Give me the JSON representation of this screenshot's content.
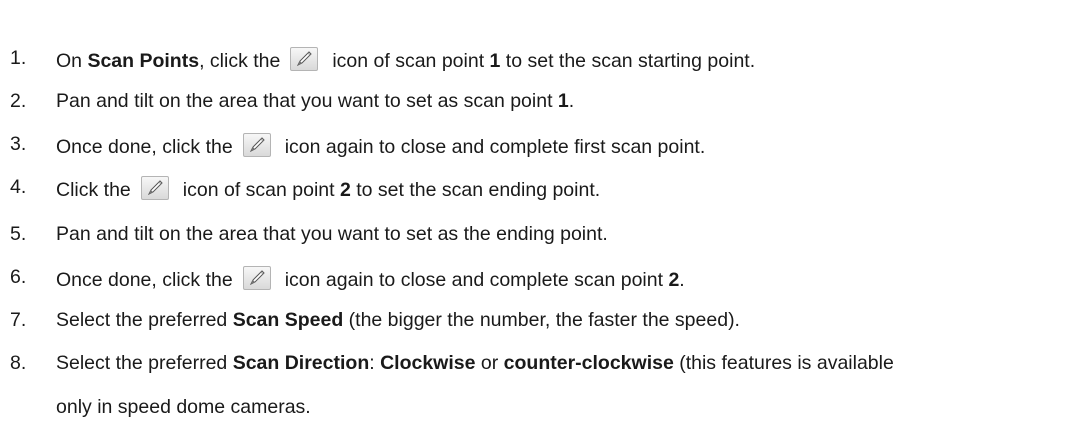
{
  "steps": [
    {
      "num": "1.",
      "parts": [
        {
          "t": "On "
        },
        {
          "t": "Scan Points",
          "b": true
        },
        {
          "t": ", click the"
        },
        {
          "icon": "pencil-edit-icon"
        },
        {
          "t": "icon of scan point "
        },
        {
          "t": "1",
          "b": true
        },
        {
          "t": " to set the scan starting point."
        }
      ]
    },
    {
      "num": "2.",
      "parts": [
        {
          "t": "Pan and tilt on the area that you want to set as scan point "
        },
        {
          "t": "1",
          "b": true
        },
        {
          "t": "."
        }
      ]
    },
    {
      "num": "3.",
      "parts": [
        {
          "t": "Once done, click the"
        },
        {
          "icon": "pencil-edit-icon"
        },
        {
          "t": "icon again to close and complete first scan point."
        }
      ]
    },
    {
      "num": "4.",
      "parts": [
        {
          "t": "Click the"
        },
        {
          "icon": "pencil-edit-icon"
        },
        {
          "t": "icon of scan point "
        },
        {
          "t": "2",
          "b": true
        },
        {
          "t": " to set the scan ending point."
        }
      ]
    },
    {
      "num": "5.",
      "parts": [
        {
          "t": "Pan and tilt on the area that you want to set as the ending point."
        }
      ]
    },
    {
      "num": "6.",
      "parts": [
        {
          "t": "Once done, click the"
        },
        {
          "icon": "pencil-edit-icon"
        },
        {
          "t": "icon again to close and complete scan point "
        },
        {
          "t": "2",
          "b": true
        },
        {
          "t": "."
        }
      ]
    },
    {
      "num": "7.",
      "parts": [
        {
          "t": "Select the preferred "
        },
        {
          "t": "Scan Speed",
          "b": true
        },
        {
          "t": " (the bigger the number, the faster the speed)."
        }
      ]
    },
    {
      "num": "8.",
      "parts": [
        {
          "t": "Select the preferred "
        },
        {
          "t": "Scan Direction",
          "b": true
        },
        {
          "t": ": "
        },
        {
          "t": "Clockwise",
          "b": true
        },
        {
          "t": " or "
        },
        {
          "t": "counter-clockwise",
          "b": true
        },
        {
          "t": " (this features is available"
        }
      ],
      "continuation": "only in speed dome cameras."
    }
  ]
}
